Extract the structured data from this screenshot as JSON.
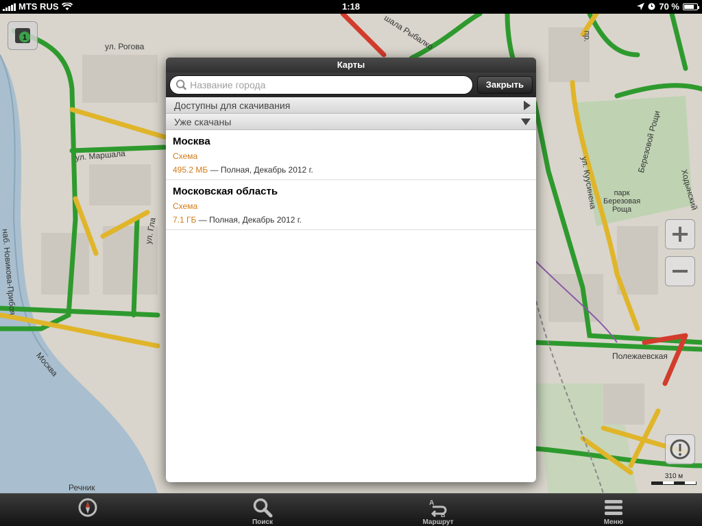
{
  "status": {
    "carrier": "MTS RUS",
    "time": "1:18",
    "battery": "70 %",
    "battery_level": 0.7
  },
  "map": {
    "labels": {
      "rogova": "ул. Рогова",
      "rybalko": "шала Рыбалко",
      "ul": "ул.",
      "narshina": "ул. Маршала",
      "novikov": "наб. Новикова-Прибоя",
      "glagoleva": "ул. Гла",
      "moskva_river": "Москва",
      "kuusinena": "ул. Куусинена",
      "berezovoy": "Березовой Рощи",
      "khodynsky": "Ходынский",
      "park": "парк\nБерезовая\nРоща",
      "polezhaevskaya": "Полежаевская",
      "rechnik": "Речник",
      "pr": "пр."
    },
    "scale_label": "310 м",
    "layers_badge": "1"
  },
  "popup": {
    "title": "Карты",
    "search_placeholder": "Название города",
    "search_value": "",
    "close_label": "Закрыть",
    "sections": {
      "available": "Доступны для скачивания",
      "downloaded": "Уже скачаны"
    },
    "regions": [
      {
        "name": "Москва",
        "type": "Схема",
        "size": "495.2 МБ",
        "details": "— Полная, Декабрь 2012 г."
      },
      {
        "name": "Московская область",
        "type": "Схема",
        "size": "7.1 ГБ",
        "details": "— Полная, Декабрь 2012 г."
      }
    ]
  },
  "toolbar": {
    "items": [
      {
        "label": "",
        "icon": "compass-icon"
      },
      {
        "label": "Поиск",
        "icon": "search-icon"
      },
      {
        "label": "Маршрут",
        "icon": "route-icon"
      },
      {
        "label": "Меню",
        "icon": "menu-icon"
      }
    ]
  },
  "colors": {
    "accent": "#d17a16",
    "traffic_green": "#2e9a2e",
    "traffic_yellow": "#e0b52a",
    "traffic_red": "#d23c2c"
  }
}
